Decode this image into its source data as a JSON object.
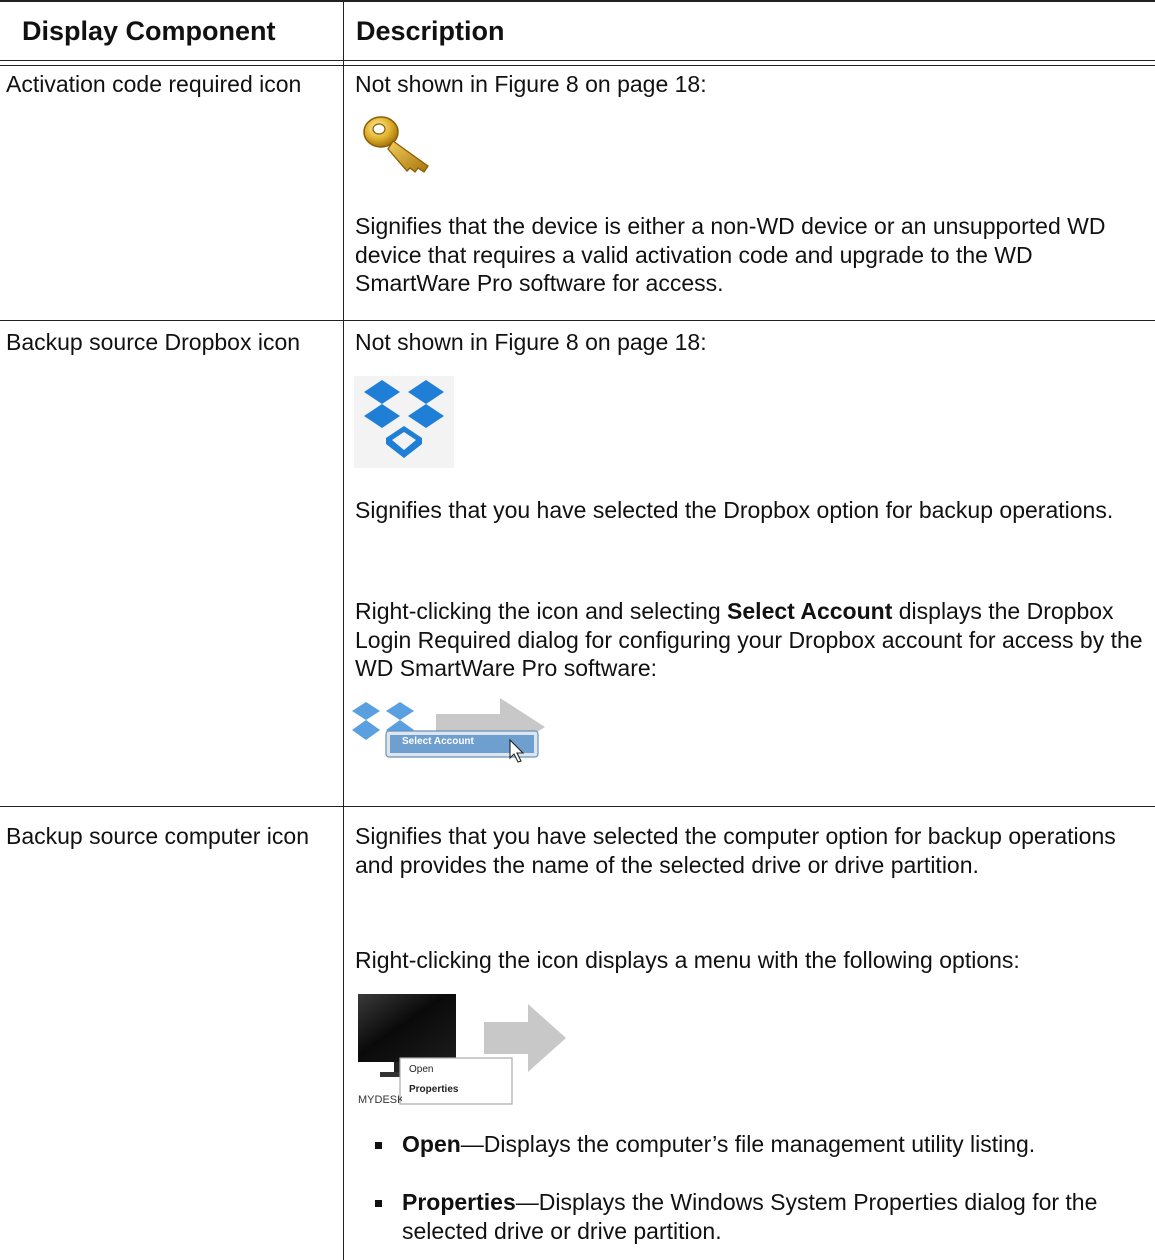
{
  "table": {
    "headers": {
      "component": "Display Component",
      "description": "Description"
    },
    "rows": [
      {
        "component": "Activation code required icon",
        "not_shown": "Not shown in Figure 8 on page 18:",
        "icon": "key-icon",
        "description": "Signifies that the device is either a non-WD device or an unsupported WD device that requires a valid activation code and upgrade to the WD SmartWare Pro software for access."
      },
      {
        "component": "Backup source Dropbox icon",
        "not_shown": "Not shown in Figure 8 on page 18:",
        "icon": "dropbox-icon",
        "description": "Signifies that you have selected the Dropbox option for backup operations.",
        "right_click_pre": "Right-clicking the icon and selecting ",
        "right_click_bold": "Select Account",
        "right_click_post": " displays the Dropbox Login Required dialog for configuring your Dropbox account for access by the WD SmartWare Pro software:",
        "menu_item": "Select Account"
      },
      {
        "component": "Backup source computer icon",
        "description": "Signifies that you have selected the computer option for backup operations and provides the name of the selected drive or drive partition.",
        "right_click": "Right-clicking the icon displays a menu with the following options:",
        "menu_items": [
          "Open",
          "Properties"
        ],
        "computer_label": "MYDESKTOP",
        "bullets": [
          {
            "term": "Open",
            "text": "—Displays the computer’s file management utility listing."
          },
          {
            "term": "Properties",
            "text": "—Displays the Windows System Properties dialog for the selected drive or drive partition."
          }
        ]
      }
    ]
  },
  "colors": {
    "key_gold": "#d4a21a",
    "dropbox_blue": "#1f7fd6",
    "arrow_gray": "#c8c8c8",
    "menu_blue": "#6f9fcf"
  }
}
